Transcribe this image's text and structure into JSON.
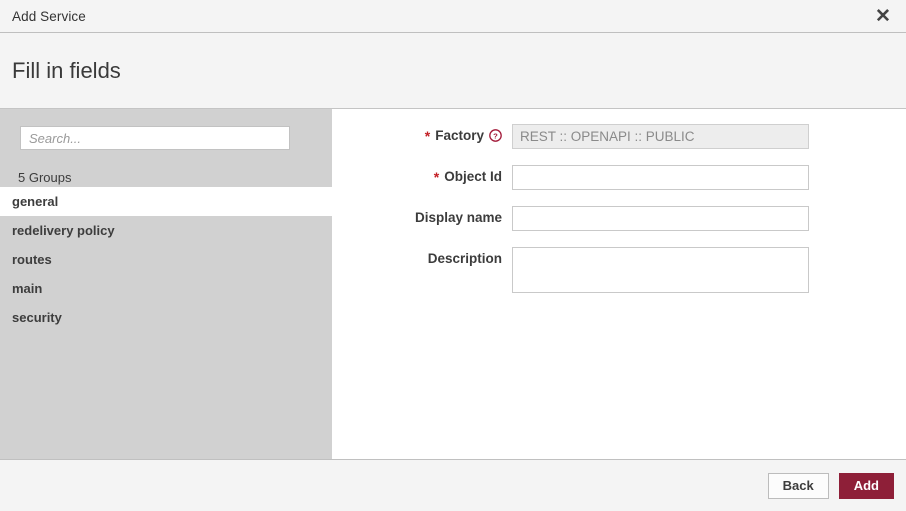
{
  "window": {
    "title": "Add Service",
    "close_icon": "close-icon",
    "close_glyph": "✕"
  },
  "heading": {
    "text": "Fill in fields"
  },
  "sidebar": {
    "search": {
      "placeholder": "Search...",
      "value": ""
    },
    "groups_count_label": "5 Groups",
    "items": [
      {
        "label": "general",
        "active": true
      },
      {
        "label": "redelivery policy",
        "active": false
      },
      {
        "label": "routes",
        "active": false
      },
      {
        "label": "main",
        "active": false
      },
      {
        "label": "security",
        "active": false
      }
    ]
  },
  "form": {
    "fields": [
      {
        "label": "Factory",
        "required": true,
        "help_icon": "help-circle-icon",
        "control": "input",
        "readonly": true,
        "value": "REST :: OPENAPI :: PUBLIC",
        "placeholder": ""
      },
      {
        "label": "Object Id",
        "required": true,
        "control": "input",
        "readonly": false,
        "value": "",
        "placeholder": ""
      },
      {
        "label": "Display name",
        "required": false,
        "control": "input",
        "readonly": false,
        "value": "",
        "placeholder": ""
      },
      {
        "label": "Description",
        "required": false,
        "control": "textarea",
        "readonly": false,
        "value": "",
        "placeholder": ""
      }
    ]
  },
  "footer": {
    "back_label": "Back",
    "add_label": "Add"
  },
  "colors": {
    "accent": "#8e1f38",
    "required_star": "#c32026",
    "sidebar_bg": "#d1d1d1",
    "band_bg": "#f4f4f4"
  }
}
